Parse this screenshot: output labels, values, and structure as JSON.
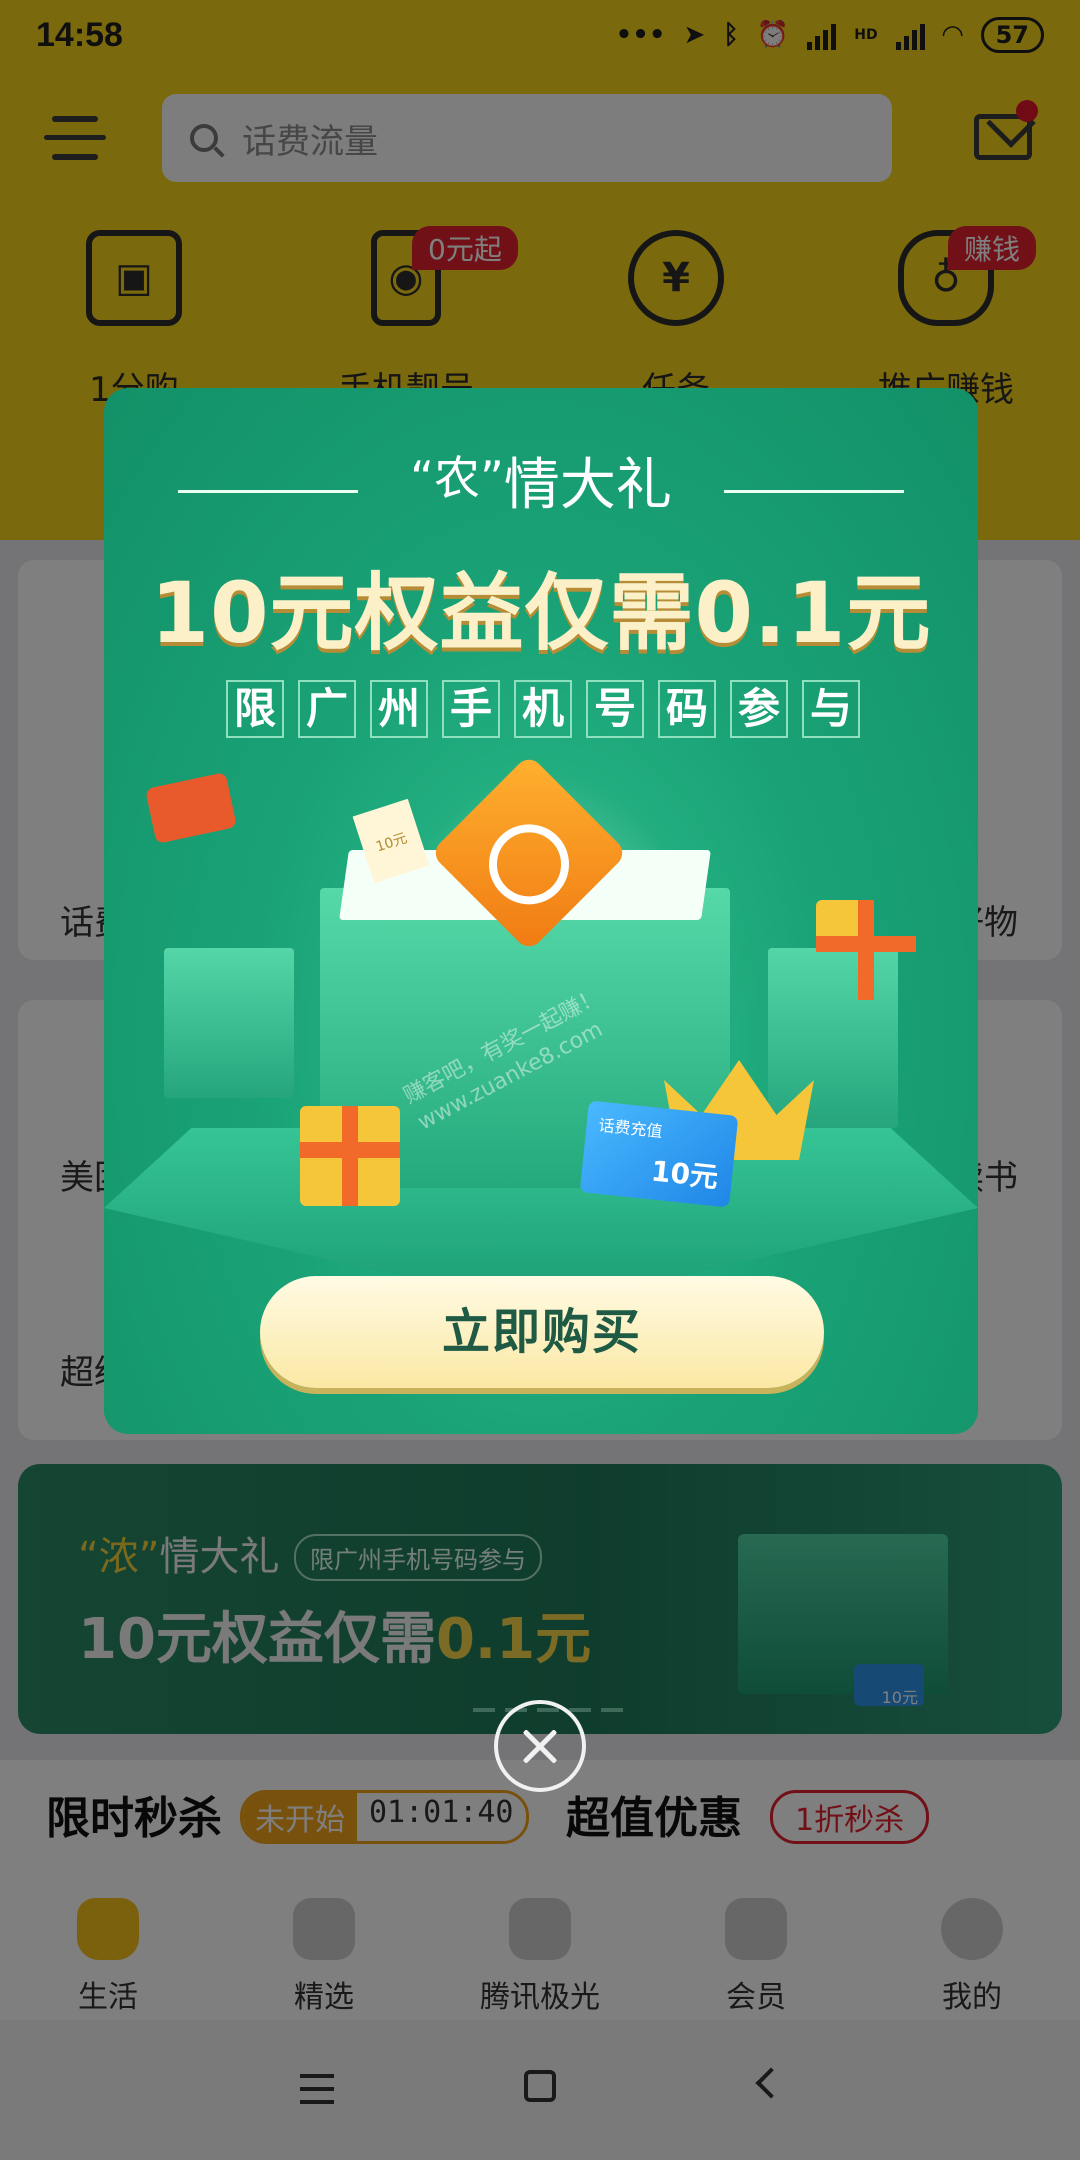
{
  "status_bar": {
    "time": "14:58",
    "battery": "57",
    "hd": "HD"
  },
  "header": {
    "search_placeholder": "话费流量"
  },
  "quick_entries": [
    {
      "label": "1分购",
      "icon": "gift-box-icon"
    },
    {
      "label": "手机靓号",
      "icon": "phone-icon",
      "tag": "0元起"
    },
    {
      "label": "任务",
      "icon": "money-bag-icon"
    },
    {
      "label": "推广赚钱",
      "icon": "piggy-bank-icon",
      "tag": "赚钱"
    }
  ],
  "background_labels": {
    "left_1": "话费",
    "right_1": "好物",
    "left_2": "美团",
    "right_2": "读书",
    "left_3": "超级"
  },
  "banner": {
    "title_quote": "“浓”",
    "title_rest": "情大礼",
    "pill": "限广州手机号码参与",
    "line2_a": "10元权益仅需",
    "line2_b": "0.1元",
    "card_amount": "10元"
  },
  "sections": {
    "flash_sale": {
      "title": "限时秒杀",
      "status": "未开始",
      "countdown": "01:01:40"
    },
    "deals": {
      "title": "超值优惠",
      "badge": "1折秒杀"
    }
  },
  "tabbar": [
    {
      "label": "生活",
      "active": true
    },
    {
      "label": "精选",
      "active": false
    },
    {
      "label": "腾讯极光",
      "active": false
    },
    {
      "label": "会员",
      "active": false
    },
    {
      "label": "我的",
      "active": false
    }
  ],
  "popup": {
    "title_quote": "“农”",
    "title_rest": "情大礼",
    "headline": "10元权益仅需0.1元",
    "limit_chars": [
      "限",
      "广",
      "州",
      "手",
      "机",
      "号",
      "码",
      "参",
      "与"
    ],
    "card_label": "话费充值",
    "card_amount": "10元",
    "coupon_text": "10元",
    "watermark_1": "赚客吧，有奖一起赚！",
    "watermark_2": "www.zuanke8.com",
    "buy_button": "立即购买"
  },
  "colors": {
    "brand_yellow": "#f6d21a",
    "popup_green": "#1aa377",
    "accent_red": "#e3222f",
    "accent_orange": "#f0a21a"
  }
}
